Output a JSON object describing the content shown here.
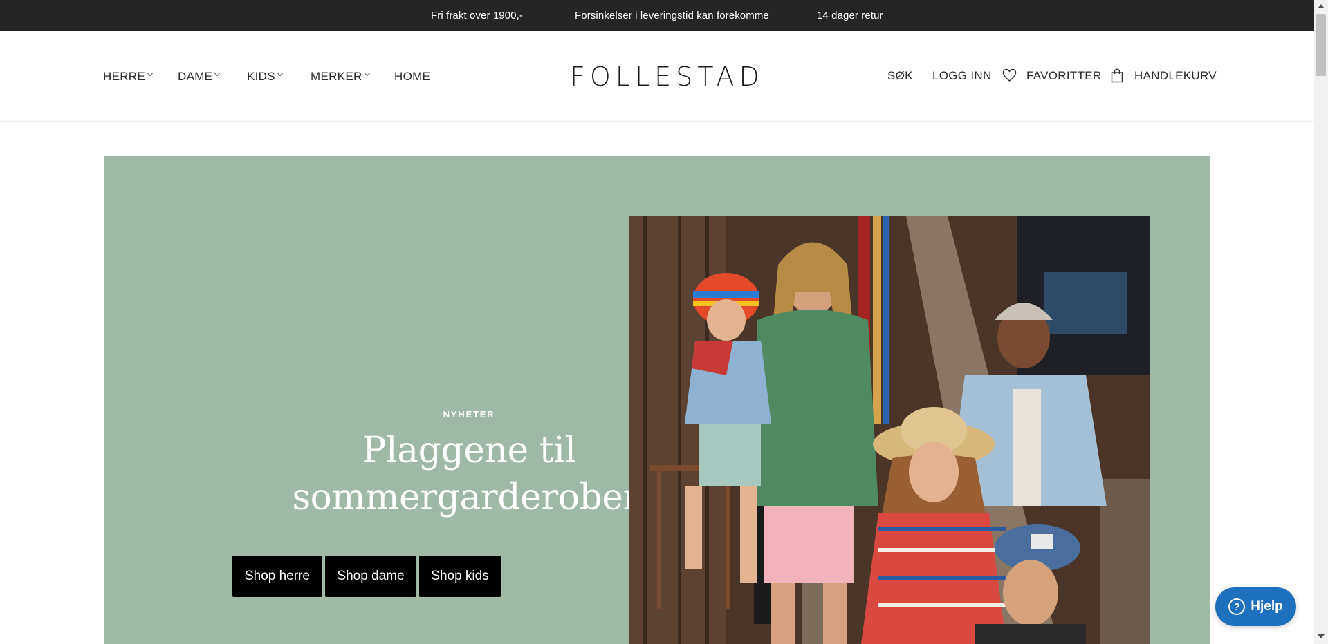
{
  "announcement": {
    "item1": "Fri frakt over 1900,-",
    "item2": "Forsinkelser i leveringstid kan forekomme",
    "item3": "14 dager retur"
  },
  "nav": {
    "herre": "HERRE",
    "dame": "DAME",
    "kids": "KIDS",
    "merker": "MERKER",
    "home": "HOME"
  },
  "logo": "FOLLESTAD",
  "utility": {
    "search": "SØK",
    "login": "LOGG INN",
    "favorites": "FAVORITTER",
    "cart": "HANDLEKURV"
  },
  "hero": {
    "eyebrow": "NYHETER",
    "headline_line1": "Plaggene til",
    "headline_line2": "sommergarderoben",
    "cta_herre": "Shop herre",
    "cta_dame": "Shop dame",
    "cta_kids": "Shop kids"
  },
  "help": {
    "label": "Hjelp",
    "icon": "?"
  },
  "colors": {
    "announcement_bg": "#252525",
    "hero_bg": "#a0b8a6",
    "cta_bg": "#000000",
    "help_bg": "#1f6fbf"
  }
}
